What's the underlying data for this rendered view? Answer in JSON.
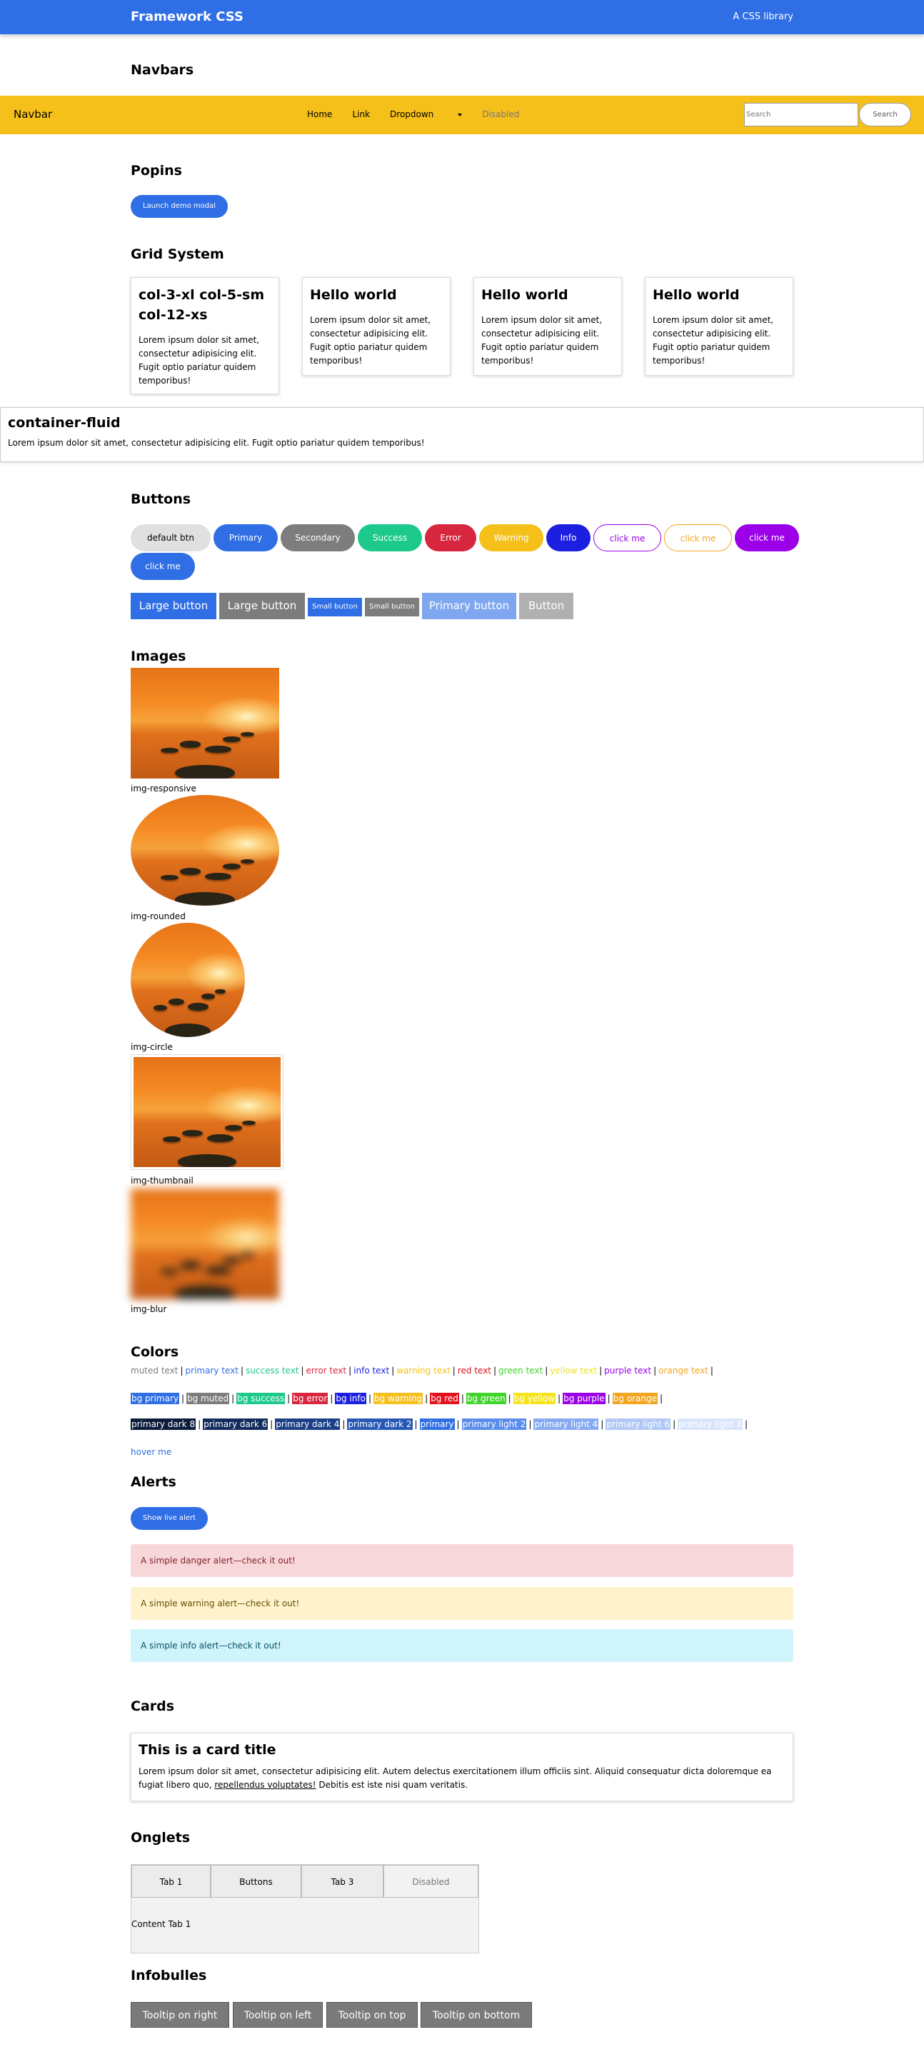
{
  "header": {
    "brand": "Framework CSS",
    "tagline": "A CSS library"
  },
  "sections": {
    "navbars": "Navbars",
    "popins": "Popins",
    "grid": "Grid System",
    "buttons": "Buttons",
    "images": "Images",
    "colors": "Colors",
    "alerts": "Alerts",
    "cards": "Cards",
    "onglets": "Onglets",
    "infobulles": "Infobulles"
  },
  "navbar": {
    "brand": "Navbar",
    "links": [
      "Home",
      "Link",
      "Dropdown",
      "Disabled"
    ],
    "search_placeholder": "Search",
    "search_button": "Search"
  },
  "popins": {
    "button": "Launch demo modal"
  },
  "grid": {
    "cards": [
      {
        "title": "col-3-xl col-5-sm col-12-xs",
        "text": "Lorem ipsum dolor sit amet, consectetur adipisicing elit. Fugit optio pariatur quidem temporibus!"
      },
      {
        "title": "Hello world",
        "text": "Lorem ipsum dolor sit amet, consectetur adipisicing elit. Fugit optio pariatur quidem temporibus!"
      },
      {
        "title": "Hello world",
        "text": "Lorem ipsum dolor sit amet, consectetur adipisicing elit. Fugit optio pariatur quidem temporibus!"
      },
      {
        "title": "Hello world",
        "text": "Lorem ipsum dolor sit amet, consectetur adipisicing elit. Fugit optio pariatur quidem temporibus!"
      }
    ],
    "fluid_title": "container-fluid",
    "fluid_text": "Lorem ipsum dolor sit amet, consectetur adipisicing elit. Fugit optio pariatur quidem temporibus!"
  },
  "buttons": {
    "row1": [
      {
        "label": "default btn",
        "bg": "#e0e0e0",
        "fg": "#000"
      },
      {
        "label": "Primary",
        "bg": "#2f6ee4",
        "fg": "#fff"
      },
      {
        "label": "Secondary",
        "bg": "#7d7d7d",
        "fg": "#fff"
      },
      {
        "label": "Success",
        "bg": "#1ec98c",
        "fg": "#fff"
      },
      {
        "label": "Error",
        "bg": "#d7263d",
        "fg": "#fff"
      },
      {
        "label": "Warning",
        "bg": "#f6c01b",
        "fg": "#fff"
      },
      {
        "label": "Info",
        "bg": "#1d1fe0",
        "fg": "#fff"
      },
      {
        "label": "click me",
        "bg": "#fff",
        "fg": "#9b00e8",
        "border": "#9b00e8"
      },
      {
        "label": "click me",
        "bg": "#fff",
        "fg": "#f3a51f",
        "border": "#f3a51f"
      },
      {
        "label": "click me",
        "bg": "#9b00e8",
        "fg": "#fff"
      }
    ],
    "row1_wrap": {
      "label": "click me",
      "bg": "#2f6ee4",
      "fg": "#fff"
    },
    "row2": [
      {
        "label": "Large button",
        "bg": "#2f6ee4"
      },
      {
        "label": "Large button",
        "bg": "#7d7d7d"
      },
      {
        "label": "Small button",
        "bg": "#2f6ee4"
      },
      {
        "label": "Small button",
        "bg": "#7d7d7d"
      },
      {
        "label": "Primary button",
        "bg": "#7fa7ef"
      },
      {
        "label": "Button",
        "bg": "#b0b0b0"
      }
    ]
  },
  "images": {
    "labels": [
      "img-responsive",
      "img-rounded",
      "img-circle",
      "img-thumbnail",
      "img-blur"
    ]
  },
  "colors": {
    "text_row": [
      {
        "label": "muted text",
        "color": "#7d7d7d"
      },
      {
        "label": "primary text",
        "color": "#2f6ee4"
      },
      {
        "label": "success text",
        "color": "#1ec98c"
      },
      {
        "label": "error text",
        "color": "#d7263d"
      },
      {
        "label": "info text",
        "color": "#1d1fe0"
      },
      {
        "label": "warning text",
        "color": "#f6c01b"
      },
      {
        "label": "red text",
        "color": "#e3111b"
      },
      {
        "label": "green text",
        "color": "#3ed62a"
      },
      {
        "label": "yellow text",
        "color": "#f4e31d"
      },
      {
        "label": "purple text",
        "color": "#9b00e8"
      },
      {
        "label": "orange text",
        "color": "#f3a51f"
      }
    ],
    "bg_row": [
      {
        "label": "bg primary",
        "color": "#2f6ee4"
      },
      {
        "label": "bg muted",
        "color": "#7d7d7d"
      },
      {
        "label": "bg success",
        "color": "#1ec98c"
      },
      {
        "label": "bg error",
        "color": "#d7263d"
      },
      {
        "label": "bg info",
        "color": "#1d1fe0"
      },
      {
        "label": "bg warning",
        "color": "#f6c01b"
      },
      {
        "label": "bg red",
        "color": "#e3111b"
      },
      {
        "label": "bg green",
        "color": "#3ed62a"
      },
      {
        "label": "bg yellow",
        "color": "#f4e31d"
      },
      {
        "label": "bg purple",
        "color": "#9b00e8"
      },
      {
        "label": "bg orange",
        "color": "#f3a51f"
      }
    ],
    "shade_row": [
      {
        "label": "primary dark 8",
        "color": "#0b1c3b"
      },
      {
        "label": "primary dark 6",
        "color": "#122b5c"
      },
      {
        "label": "primary dark 4",
        "color": "#1a3f86"
      },
      {
        "label": "primary dark 2",
        "color": "#2657b5"
      },
      {
        "label": "primary",
        "color": "#2f6ee4"
      },
      {
        "label": "primary light 2",
        "color": "#5a8ceb"
      },
      {
        "label": "primary light 4",
        "color": "#86aaf0"
      },
      {
        "label": "primary light 6",
        "color": "#b1c8f5"
      },
      {
        "label": "primary light 8",
        "color": "#d9e5fb"
      }
    ],
    "hover": "hover me"
  },
  "alerts": {
    "button": "Show live alert",
    "items": [
      {
        "text": "A simple danger alert—check it out!",
        "bg": "#f8d7da",
        "fg": "#842029"
      },
      {
        "text": "A simple warning alert—check it out!",
        "bg": "#fff3cd",
        "fg": "#664d03"
      },
      {
        "text": "A simple info alert—check it out!",
        "bg": "#cff4fc",
        "fg": "#055160"
      }
    ]
  },
  "card": {
    "title": "This is a card title",
    "text_before": "Lorem ipsum dolor sit amet, consectetur adipisicing elit. Autem delectus exercitationem illum officiis sint. Aliquid consequatur dicta doloremque ea fugiat libero quo, ",
    "link": "repellendus voluptates!",
    "text_after": " Debitis est iste nisi quam veritatis."
  },
  "tabs": {
    "items": [
      "Tab 1",
      "Buttons",
      "Tab 3",
      "Disabled"
    ],
    "content": "Content Tab 1"
  },
  "tooltips": [
    "Tooltip on right",
    "Tooltip on left",
    "Tooltip on top",
    "Tooltip on bottom"
  ]
}
